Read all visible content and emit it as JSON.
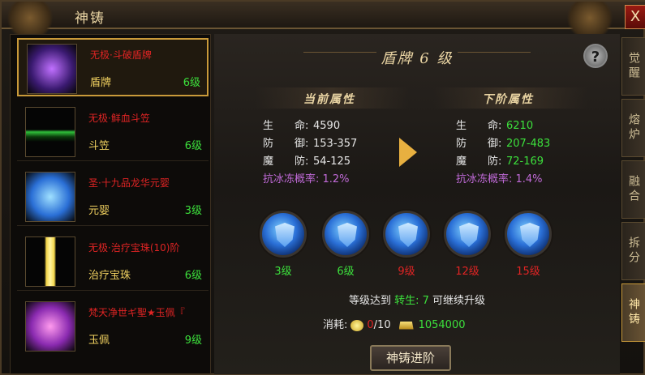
{
  "window": {
    "title": "神铸",
    "close_label": "X"
  },
  "items": [
    {
      "name": "无极·斗破盾牌",
      "type": "盾牌",
      "level": "6级",
      "icon": "shield-relic-icon",
      "selected": true
    },
    {
      "name": "无极·鲜血斗笠",
      "type": "斗笠",
      "level": "6级",
      "icon": "hat-icon",
      "selected": false
    },
    {
      "name": "圣·十九品龙华元婴",
      "type": "元婴",
      "level": "3级",
      "icon": "spirit-icon",
      "selected": false
    },
    {
      "name": "无极·治疗宝珠(10)阶",
      "type": "治疗宝珠",
      "level": "6级",
      "icon": "orb-icon",
      "selected": false
    },
    {
      "name": "梵天净世ギ聖★玉佩『",
      "type": "玉佩",
      "level": "9级",
      "icon": "jade-icon",
      "selected": false
    }
  ],
  "panel": {
    "heading": "盾牌 6 级",
    "help_label": "?",
    "current": {
      "title": "当前属性",
      "rows": [
        {
          "k": "生　　命:",
          "v": "4590"
        },
        {
          "k": "防　　御:",
          "v": "153-357"
        },
        {
          "k": "魔　　防:",
          "v": "54-125"
        }
      ],
      "extra": "抗冰冻概率: 1.2%"
    },
    "next": {
      "title": "下阶属性",
      "rows": [
        {
          "k": "生　　命:",
          "v": "6210"
        },
        {
          "k": "防　　御:",
          "v": "207-483"
        },
        {
          "k": "魔　　防:",
          "v": "72-169"
        }
      ],
      "extra": "抗冰冻概率: 1.4%"
    },
    "stages": [
      {
        "level": "3级",
        "color": "#3ce03c"
      },
      {
        "level": "6级",
        "color": "#3ce03c"
      },
      {
        "level": "9级",
        "color": "#e02424"
      },
      {
        "level": "12级",
        "color": "#e02424"
      },
      {
        "level": "15级",
        "color": "#e02424"
      }
    ],
    "condition": {
      "prefix": "等级达到",
      "req_label": "转生:",
      "req_value": "7",
      "suffix": "可继续升级"
    },
    "cost": {
      "label": "消耗:",
      "item_have": "0",
      "item_need": "/10",
      "gold": "1054000"
    },
    "action_label": "神铸进阶"
  },
  "tabs": [
    {
      "label": "觉醒",
      "active": false
    },
    {
      "label": "熔炉",
      "active": false
    },
    {
      "label": "融合",
      "active": false
    },
    {
      "label": "拆分",
      "active": false
    },
    {
      "label": "神铸",
      "active": true
    }
  ]
}
